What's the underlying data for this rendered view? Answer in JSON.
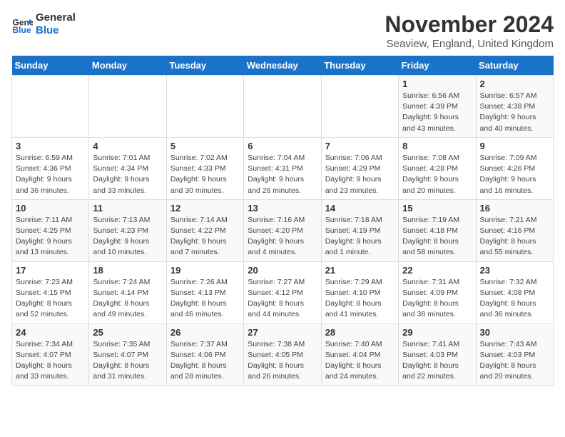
{
  "header": {
    "logo_line1": "General",
    "logo_line2": "Blue",
    "month": "November 2024",
    "location": "Seaview, England, United Kingdom"
  },
  "weekdays": [
    "Sunday",
    "Monday",
    "Tuesday",
    "Wednesday",
    "Thursday",
    "Friday",
    "Saturday"
  ],
  "weeks": [
    [
      {
        "day": "",
        "info": ""
      },
      {
        "day": "",
        "info": ""
      },
      {
        "day": "",
        "info": ""
      },
      {
        "day": "",
        "info": ""
      },
      {
        "day": "",
        "info": ""
      },
      {
        "day": "1",
        "info": "Sunrise: 6:56 AM\nSunset: 4:39 PM\nDaylight: 9 hours\nand 43 minutes."
      },
      {
        "day": "2",
        "info": "Sunrise: 6:57 AM\nSunset: 4:38 PM\nDaylight: 9 hours\nand 40 minutes."
      }
    ],
    [
      {
        "day": "3",
        "info": "Sunrise: 6:59 AM\nSunset: 4:36 PM\nDaylight: 9 hours\nand 36 minutes."
      },
      {
        "day": "4",
        "info": "Sunrise: 7:01 AM\nSunset: 4:34 PM\nDaylight: 9 hours\nand 33 minutes."
      },
      {
        "day": "5",
        "info": "Sunrise: 7:02 AM\nSunset: 4:33 PM\nDaylight: 9 hours\nand 30 minutes."
      },
      {
        "day": "6",
        "info": "Sunrise: 7:04 AM\nSunset: 4:31 PM\nDaylight: 9 hours\nand 26 minutes."
      },
      {
        "day": "7",
        "info": "Sunrise: 7:06 AM\nSunset: 4:29 PM\nDaylight: 9 hours\nand 23 minutes."
      },
      {
        "day": "8",
        "info": "Sunrise: 7:08 AM\nSunset: 4:28 PM\nDaylight: 9 hours\nand 20 minutes."
      },
      {
        "day": "9",
        "info": "Sunrise: 7:09 AM\nSunset: 4:26 PM\nDaylight: 9 hours\nand 16 minutes."
      }
    ],
    [
      {
        "day": "10",
        "info": "Sunrise: 7:11 AM\nSunset: 4:25 PM\nDaylight: 9 hours\nand 13 minutes."
      },
      {
        "day": "11",
        "info": "Sunrise: 7:13 AM\nSunset: 4:23 PM\nDaylight: 9 hours\nand 10 minutes."
      },
      {
        "day": "12",
        "info": "Sunrise: 7:14 AM\nSunset: 4:22 PM\nDaylight: 9 hours\nand 7 minutes."
      },
      {
        "day": "13",
        "info": "Sunrise: 7:16 AM\nSunset: 4:20 PM\nDaylight: 9 hours\nand 4 minutes."
      },
      {
        "day": "14",
        "info": "Sunrise: 7:18 AM\nSunset: 4:19 PM\nDaylight: 9 hours\nand 1 minute."
      },
      {
        "day": "15",
        "info": "Sunrise: 7:19 AM\nSunset: 4:18 PM\nDaylight: 8 hours\nand 58 minutes."
      },
      {
        "day": "16",
        "info": "Sunrise: 7:21 AM\nSunset: 4:16 PM\nDaylight: 8 hours\nand 55 minutes."
      }
    ],
    [
      {
        "day": "17",
        "info": "Sunrise: 7:23 AM\nSunset: 4:15 PM\nDaylight: 8 hours\nand 52 minutes."
      },
      {
        "day": "18",
        "info": "Sunrise: 7:24 AM\nSunset: 4:14 PM\nDaylight: 8 hours\nand 49 minutes."
      },
      {
        "day": "19",
        "info": "Sunrise: 7:26 AM\nSunset: 4:13 PM\nDaylight: 8 hours\nand 46 minutes."
      },
      {
        "day": "20",
        "info": "Sunrise: 7:27 AM\nSunset: 4:12 PM\nDaylight: 8 hours\nand 44 minutes."
      },
      {
        "day": "21",
        "info": "Sunrise: 7:29 AM\nSunset: 4:10 PM\nDaylight: 8 hours\nand 41 minutes."
      },
      {
        "day": "22",
        "info": "Sunrise: 7:31 AM\nSunset: 4:09 PM\nDaylight: 8 hours\nand 38 minutes."
      },
      {
        "day": "23",
        "info": "Sunrise: 7:32 AM\nSunset: 4:08 PM\nDaylight: 8 hours\nand 36 minutes."
      }
    ],
    [
      {
        "day": "24",
        "info": "Sunrise: 7:34 AM\nSunset: 4:07 PM\nDaylight: 8 hours\nand 33 minutes."
      },
      {
        "day": "25",
        "info": "Sunrise: 7:35 AM\nSunset: 4:07 PM\nDaylight: 8 hours\nand 31 minutes."
      },
      {
        "day": "26",
        "info": "Sunrise: 7:37 AM\nSunset: 4:06 PM\nDaylight: 8 hours\nand 28 minutes."
      },
      {
        "day": "27",
        "info": "Sunrise: 7:38 AM\nSunset: 4:05 PM\nDaylight: 8 hours\nand 26 minutes."
      },
      {
        "day": "28",
        "info": "Sunrise: 7:40 AM\nSunset: 4:04 PM\nDaylight: 8 hours\nand 24 minutes."
      },
      {
        "day": "29",
        "info": "Sunrise: 7:41 AM\nSunset: 4:03 PM\nDaylight: 8 hours\nand 22 minutes."
      },
      {
        "day": "30",
        "info": "Sunrise: 7:43 AM\nSunset: 4:03 PM\nDaylight: 8 hours\nand 20 minutes."
      }
    ]
  ]
}
